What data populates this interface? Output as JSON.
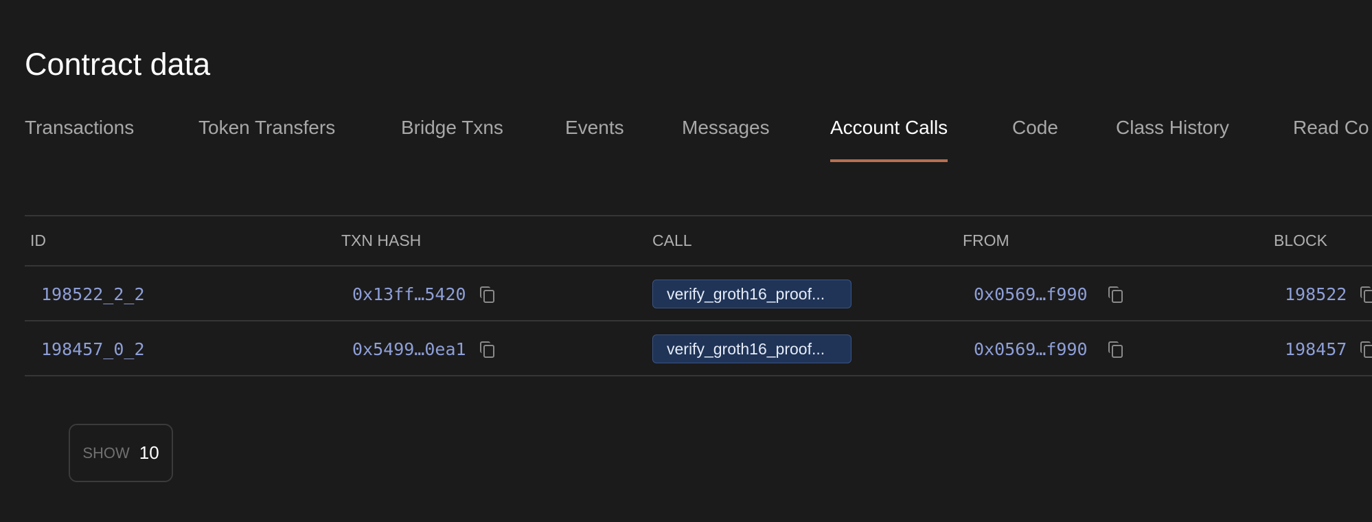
{
  "page_title": "Contract data",
  "tabs": [
    {
      "label": "Transactions",
      "active": false
    },
    {
      "label": "Token Transfers",
      "active": false
    },
    {
      "label": "Bridge Txns",
      "active": false
    },
    {
      "label": "Events",
      "active": false
    },
    {
      "label": "Messages",
      "active": false
    },
    {
      "label": "Account Calls",
      "active": true
    },
    {
      "label": "Code",
      "active": false
    },
    {
      "label": "Class History",
      "active": false
    },
    {
      "label": "Read Co",
      "active": false
    }
  ],
  "table": {
    "headers": [
      "ID",
      "TXN HASH",
      "CALL",
      "FROM",
      "BLOCK"
    ],
    "rows": [
      {
        "id": "198522_2_2",
        "txn_hash": "0x13ff…5420",
        "call": "verify_groth16_proof...",
        "from": "0x0569…f990",
        "block": "198522"
      },
      {
        "id": "198457_0_2",
        "txn_hash": "0x5499…0ea1",
        "call": "verify_groth16_proof...",
        "from": "0x0569…f990",
        "block": "198457"
      }
    ]
  },
  "pagination": {
    "show_label": "SHOW",
    "show_value": "10"
  },
  "colors": {
    "accent": "#b86f52",
    "link": "#8e9fd8",
    "badge_bg": "#1f3457",
    "background": "#1b1b1b"
  }
}
